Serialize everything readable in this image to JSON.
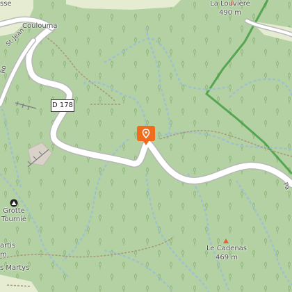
{
  "map": {
    "region": "forest",
    "labels": {
      "top_left_partial": "sse",
      "village": "Coulouma",
      "road_partial_left": "St-Jean",
      "road_partial_left2": "Ro",
      "road_shield": "D 178",
      "peak_north_name": "La Louvière",
      "peak_north_alt": "490 m",
      "peak_south_name": "Le Cadenas",
      "peak_south_alt": "469 m",
      "cave_name_1": "Grotte",
      "cave_name_2": "Tournié",
      "left_partial_1": "artis",
      "left_partial_2": "m",
      "left_partial_3": "s Martys",
      "right_road_partial": "Pa"
    },
    "colors": {
      "forest": "#b3d1a2",
      "clearing": "#e6ecd2",
      "road": "#ffffff",
      "road_casing": "#b8b8b8",
      "path": "#9ec1cf",
      "track": "#a89a7a",
      "boundary": "#3f9a3f",
      "marker": "#ef6c1f"
    },
    "icons": [
      "location-pin-icon",
      "peak-triangle-icon",
      "cave-icon",
      "tree-pattern-icon"
    ]
  }
}
